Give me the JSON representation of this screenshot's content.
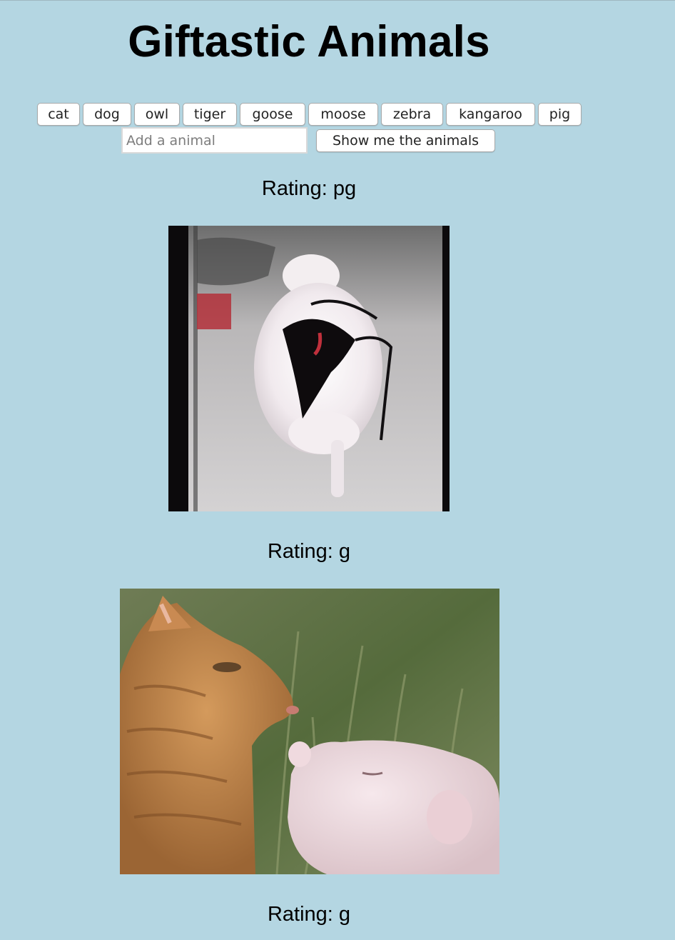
{
  "header": {
    "title": "Giftastic Animals"
  },
  "animal_buttons": [
    "cat",
    "dog",
    "owl",
    "tiger",
    "goose",
    "moose",
    "zebra",
    "kangaroo",
    "pig"
  ],
  "search": {
    "placeholder": "Add a animal",
    "value": "",
    "submit_label": "Show me the animals"
  },
  "results": [
    {
      "rating": "Rating: pg",
      "image": "pig-in-bikini-gif"
    },
    {
      "rating": "Rating: g",
      "image": "cat-and-piglet-gif"
    },
    {
      "rating": "Rating: g"
    }
  ],
  "colors": {
    "page_background": "#b4d6e2",
    "button_background": "#ffffff",
    "button_border": "#a9a9a9"
  }
}
